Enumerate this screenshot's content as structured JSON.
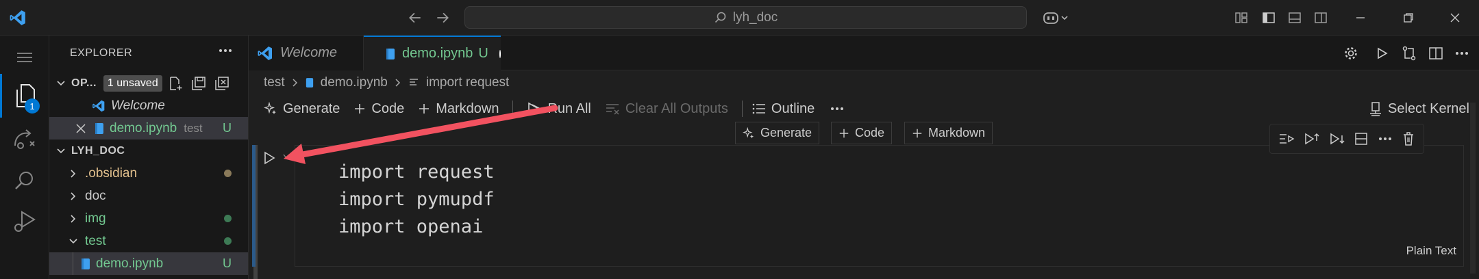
{
  "titlebar": {
    "search_text": "lyh_doc"
  },
  "activity": {
    "explorer_badge": "1"
  },
  "sidebar": {
    "title": "EXPLORER",
    "open_editors": {
      "label": "OP...",
      "unsaved_badge": "1 unsaved",
      "items": [
        {
          "name": "Welcome"
        },
        {
          "name": "demo.ipynb",
          "folder": "test",
          "status": "U"
        }
      ]
    },
    "folder": {
      "label": "LYH_DOC",
      "items": [
        {
          "name": ".obsidian"
        },
        {
          "name": "doc"
        },
        {
          "name": "img"
        },
        {
          "name": "test"
        },
        {
          "name": "demo.ipynb",
          "status": "U"
        }
      ]
    }
  },
  "tabs": [
    {
      "label": "Welcome"
    },
    {
      "label": "demo.ipynb",
      "status": "U"
    }
  ],
  "breadcrumb": [
    "test",
    "demo.ipynb",
    "import request"
  ],
  "toolbar": {
    "generate": "Generate",
    "code": "Code",
    "markdown": "Markdown",
    "run_all": "Run All",
    "clear_outputs": "Clear All Outputs",
    "outline": "Outline",
    "select_kernel": "Select Kernel"
  },
  "insert_bar": {
    "generate": "Generate",
    "code": "Code",
    "markdown": "Markdown"
  },
  "cell": {
    "lines": [
      "import request",
      "import pymupdf",
      "import openai"
    ],
    "language": "Plain Text"
  },
  "colors": {
    "accent": "#0078d4",
    "untracked": "#73c991",
    "folder_modified": "#e2c08d",
    "arrow": "#f25260"
  }
}
